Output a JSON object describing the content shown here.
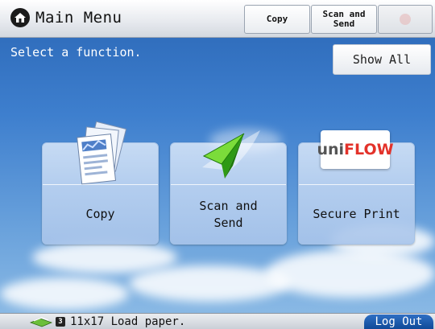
{
  "header": {
    "title": "Main Menu",
    "icon": "home-icon",
    "tabs": [
      {
        "label": "Copy"
      },
      {
        "label": "Scan and\nSend",
        "line1": "Scan and",
        "line2": "Send"
      },
      {
        "label": "",
        "icon": "inactive-function-icon"
      }
    ]
  },
  "prompt": "Select a function.",
  "show_all_label": "Show All",
  "tiles": [
    {
      "label": "Copy",
      "icon": "copy-documents-icon"
    },
    {
      "label": "Scan and\nSend",
      "line1": "Scan and",
      "line2": "Send",
      "icon": "paper-plane-icon"
    },
    {
      "label": "Secure Print",
      "icon": "uniflow-logo",
      "logo_text_uni": "uni",
      "logo_text_flow": "FLOW"
    }
  ],
  "status": {
    "icon": "paper-tray-icon",
    "tray_number": "3",
    "message": "11x17 Load paper."
  },
  "logout_label": "Log Out",
  "colors": {
    "accent_blue": "#0f4a98",
    "sky": "#3e7fce",
    "uniflow_red": "#e3322a"
  }
}
